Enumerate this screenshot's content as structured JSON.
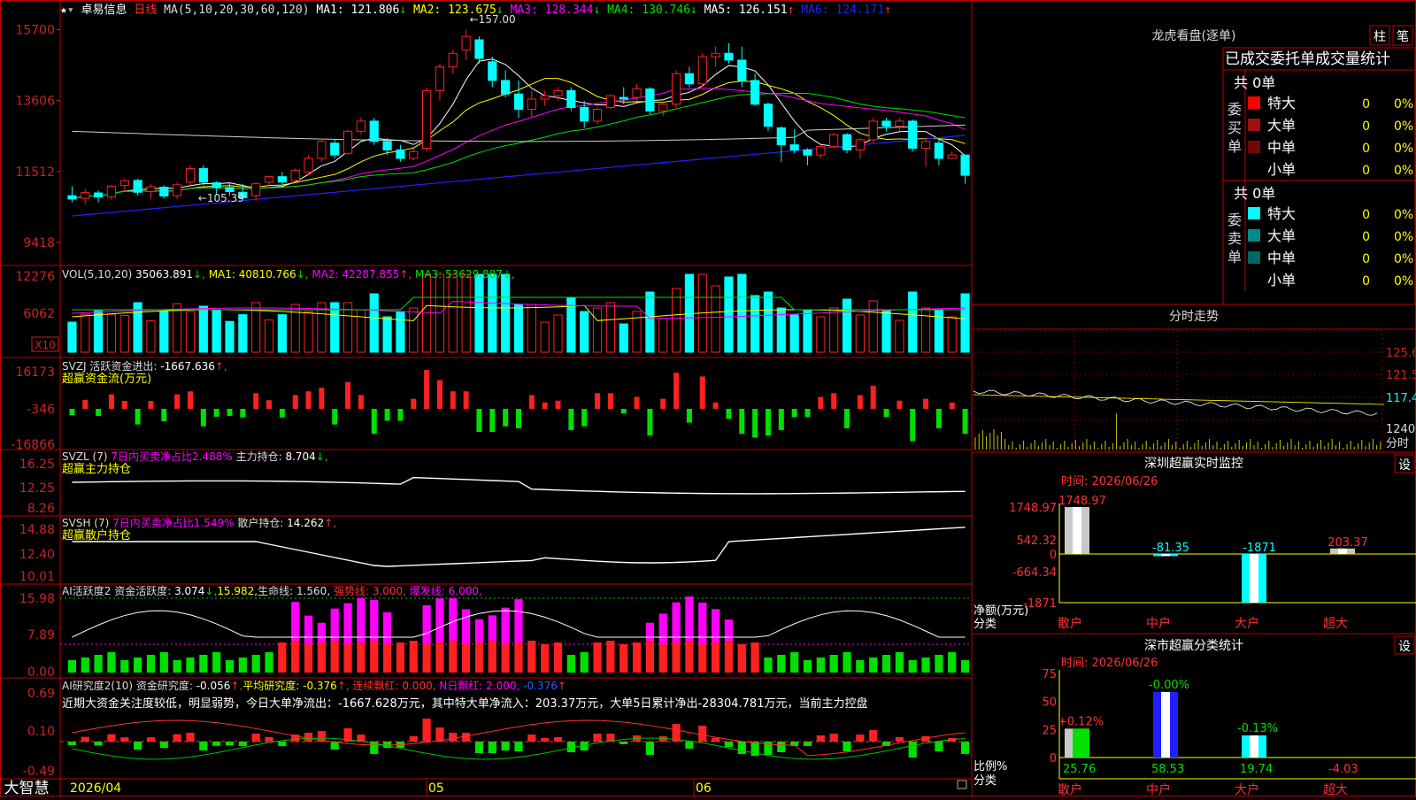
{
  "stock": {
    "name": "卓易信息",
    "period": "日线"
  },
  "brand": "大智慧",
  "colors": {
    "up": "#ff2020",
    "down": "#00ffff",
    "frame": "#c00000",
    "axis": "#d02020",
    "white": "#e8e8e8",
    "yellow": "#ffff00",
    "magenta": "#ff00ff",
    "green": "#00e000",
    "blue": "#1b1bff"
  },
  "kline": {
    "header": {
      "ma_set": "MA(5,10,20,30,60,120)",
      "ma": [
        {
          "name": "MA1",
          "value": "121.806",
          "arrow": "↓",
          "color": "#ffffff"
        },
        {
          "name": "MA2",
          "value": "123.675",
          "arrow": "↓",
          "color": "#ffff00"
        },
        {
          "name": "MA3",
          "value": "128.344",
          "arrow": "↓",
          "color": "#ff00ff"
        },
        {
          "name": "MA4",
          "value": "130.746",
          "arrow": "↓",
          "color": "#00e000"
        },
        {
          "name": "MA5",
          "value": "126.151",
          "arrow": "↑",
          "color": "#ffffff"
        },
        {
          "name": "MA6",
          "value": "124.171",
          "arrow": "↑",
          "color": "#2222ff"
        }
      ]
    },
    "y_ticks": [
      "15700",
      "13606",
      "11512",
      "9418"
    ],
    "annotations": {
      "high": "157.00",
      "low": "105.39"
    }
  },
  "volume": {
    "header": {
      "title": "VOL(5,10,20)",
      "value": "35063.891",
      "arrow": "↓",
      "ma": [
        {
          "name": "MA1",
          "value": "40810.766",
          "arrow": "↓",
          "color": "#ffff00"
        },
        {
          "name": "MA2",
          "value": "42287.855",
          "arrow": "↑",
          "color": "#ff00ff"
        },
        {
          "name": "MA3",
          "value": "53629.887",
          "arrow": "↓",
          "color": "#00e000"
        }
      ]
    },
    "y_ticks": [
      "12276",
      "6062"
    ],
    "unit": "X10"
  },
  "svzj": {
    "title": "SVZJ",
    "label": "活跃资金进出:",
    "value": "-1667.636",
    "arrow": "↑",
    "sub": "超赢资金流(万元)",
    "y_ticks": [
      "16173",
      "-346",
      "-16866"
    ]
  },
  "svzl": {
    "title": "SVZL (7)",
    "label1": "7日内买卖净占比2.488%",
    "label2": "主力持仓:",
    "value": "8.704",
    "arrow": "↓",
    "sub": "超赢主力持仓",
    "y_ticks": [
      "16.25",
      "12.25",
      "8.26"
    ]
  },
  "svsh": {
    "title": "SVSH (7)",
    "label1": "7日内买卖净占比1.549%",
    "label2": "散户持仓:",
    "value": "14.262",
    "arrow": "↑",
    "sub": "超赢散户持仓",
    "y_ticks": [
      "14.88",
      "12.40",
      "10.01"
    ]
  },
  "ai_active": {
    "title": "AI活跃度2",
    "label": "资金活跃度:",
    "value": "3.074",
    "arrow": "↓",
    "v2": "15.982",
    "life_label": "生命线:",
    "life": "1.560",
    "strong_label": "强势线:",
    "strong": "3.000",
    "burst_label": "爆发线:",
    "burst": "6.000",
    "y_ticks": [
      "15.98",
      "7.89",
      "0.00"
    ]
  },
  "ai_research": {
    "title": "AI研究度2(10)",
    "label": "资金研究度:",
    "value": "-0.056",
    "arrow": "↑",
    "avg_label": "平均研究度:",
    "avg": "-0.376",
    "avg_arrow": "↑",
    "red_label": "连续飘红:",
    "red": "0.000",
    "nred_label": "N日飘红:",
    "nred": "2.000",
    "last": "-0.376",
    "last_arrow": "↑",
    "commentary": "近期大资金关注度较低，明显弱势，今日大单净流出：-1667.628万元，其中特大单净流入：203.37万元，大单5日累计净出-28304.781万元，当前主力控盘",
    "y_ticks": [
      "0.69",
      "0.10",
      "-0.49"
    ]
  },
  "x_axis": {
    "start": "2026/04",
    "m1": "05",
    "m2": "06"
  },
  "right": {
    "lhb": {
      "title": "龙虎看盘(逐单)",
      "btn1": "柱",
      "btn2": "笔",
      "stats_title": "已成交委托单成交量统计",
      "buy": {
        "side": "委买单",
        "total": "共 0单",
        "rows": [
          {
            "name": "特大",
            "count": "0",
            "pct": "0%",
            "color": "#ff0000"
          },
          {
            "name": "大单",
            "count": "0",
            "pct": "0%",
            "color": "#a01010"
          },
          {
            "name": "中单",
            "count": "0",
            "pct": "0%",
            "color": "#700808"
          },
          {
            "name": "小单",
            "count": "0",
            "pct": "0%",
            "color": "#000000"
          }
        ]
      },
      "sell": {
        "side": "委卖单",
        "total": "共 0单",
        "rows": [
          {
            "name": "特大",
            "count": "0",
            "pct": "0%",
            "color": "#00ffff"
          },
          {
            "name": "大单",
            "count": "0",
            "pct": "0%",
            "color": "#008b8b"
          },
          {
            "name": "中单",
            "count": "0",
            "pct": "0%",
            "color": "#006666"
          },
          {
            "name": "小单",
            "count": "0",
            "pct": "0%",
            "color": "#000000"
          }
        ]
      }
    },
    "intraday": {
      "title": "分时走势",
      "ticks": [
        "125.6",
        "121.5",
        "117.4",
        "1240"
      ],
      "unit": "分时"
    },
    "monitor": {
      "title": "深圳超赢实时监控",
      "btn": "设",
      "date": "时间: 2026/06/26",
      "y_ticks": [
        "1748.97",
        "542.32",
        "0",
        "-664.34",
        "-1871"
      ],
      "unit_label": "净额(万元)",
      "cat_label": "分类",
      "categories": [
        "散户",
        "中户",
        "大户",
        "超大"
      ],
      "values": [
        1748.97,
        -81.35,
        -1871,
        203.37
      ],
      "labels": [
        "1748.97",
        "-81.35",
        "-1871",
        "203.37"
      ]
    },
    "classify": {
      "title": "深市超赢分类统计",
      "btn": "设",
      "date": "时间: 2026/06/26",
      "y_ticks": [
        "75",
        "50",
        "25",
        "0"
      ],
      "unit_label": "比例%",
      "cat_label": "分类",
      "categories": [
        "散户",
        "中户",
        "大户",
        "超大"
      ],
      "bars": [
        25.76,
        58.53,
        19.74,
        -4.03
      ],
      "bar_labels": [
        "25.76",
        "58.53",
        "19.74",
        "-4.03"
      ],
      "changes": [
        "+0.12%",
        "-0.00%",
        "-0.13%",
        ""
      ]
    }
  },
  "chart_data": {
    "type": "candlestick",
    "title": "卓易信息 日线",
    "ohlc": [
      [
        108.0,
        110.8,
        106.0,
        107.0
      ],
      [
        107.2,
        110.0,
        105.6,
        108.9
      ],
      [
        108.8,
        109.5,
        106.0,
        107.6
      ],
      [
        107.6,
        111.2,
        106.8,
        110.8
      ],
      [
        111.0,
        113.0,
        109.4,
        112.4
      ],
      [
        112.5,
        113.0,
        108.0,
        109.0
      ],
      [
        109.2,
        111.5,
        107.0,
        110.6
      ],
      [
        110.5,
        111.0,
        107.2,
        107.9
      ],
      [
        108.0,
        112.0,
        107.0,
        111.2
      ],
      [
        112.0,
        117.0,
        111.0,
        116.0
      ],
      [
        116.0,
        117.0,
        111.0,
        112.0
      ],
      [
        111.8,
        112.2,
        108.0,
        110.4
      ],
      [
        110.4,
        112.0,
        108.0,
        109.2
      ],
      [
        109.0,
        111.5,
        107.0,
        107.4
      ],
      [
        108.0,
        112.0,
        106.5,
        111.5
      ],
      [
        112.0,
        114.0,
        111.0,
        113.6
      ],
      [
        113.6,
        115.0,
        111.0,
        112.0
      ],
      [
        112.5,
        116.0,
        112.0,
        115.5
      ],
      [
        115.0,
        120.0,
        114.0,
        119.0
      ],
      [
        119.0,
        125.0,
        118.0,
        124.0
      ],
      [
        123.5,
        124.5,
        119.0,
        120.0
      ],
      [
        120.5,
        127.5,
        120.0,
        127.0
      ],
      [
        127.0,
        131.0,
        126.0,
        130.0
      ],
      [
        130.0,
        131.0,
        123.0,
        124.0
      ],
      [
        124.0,
        125.0,
        120.0,
        121.5
      ],
      [
        121.5,
        123.0,
        118.0,
        119.0
      ],
      [
        119.0,
        122.0,
        118.5,
        121.0
      ],
      [
        122.0,
        140.0,
        121.0,
        139.0
      ],
      [
        139.0,
        147.0,
        136.0,
        146.0
      ],
      [
        146.0,
        151.0,
        144.0,
        150.0
      ],
      [
        151.0,
        157.0,
        148.0,
        155.0
      ],
      [
        154.0,
        155.0,
        147.0,
        148.5
      ],
      [
        147.5,
        149.0,
        140.0,
        142.0
      ],
      [
        142.0,
        145.0,
        137.0,
        138.0
      ],
      [
        138.0,
        142.0,
        131.0,
        133.5
      ],
      [
        133.5,
        139.0,
        131.0,
        136.5
      ],
      [
        136.5,
        139.0,
        134.5,
        137.5
      ],
      [
        137.5,
        140.0,
        136.0,
        139.0
      ],
      [
        139.0,
        140.0,
        133.0,
        134.0
      ],
      [
        134.0,
        136.0,
        128.0,
        130.0
      ],
      [
        130.0,
        134.0,
        129.0,
        133.5
      ],
      [
        134.0,
        138.0,
        133.5,
        137.5
      ],
      [
        137.0,
        140.0,
        135.0,
        136.5
      ],
      [
        137.0,
        141.0,
        136.0,
        139.5
      ],
      [
        139.5,
        140.0,
        132.0,
        133.0
      ],
      [
        133.0,
        136.0,
        131.5,
        135.0
      ],
      [
        135.0,
        145.0,
        134.0,
        144.0
      ],
      [
        144.0,
        146.0,
        140.0,
        141.0
      ],
      [
        141.0,
        150.0,
        140.0,
        149.0
      ],
      [
        149.0,
        152.0,
        146.0,
        150.0
      ],
      [
        150.0,
        153.0,
        147.0,
        148.0
      ],
      [
        148.0,
        152.0,
        140.0,
        142.0
      ],
      [
        142.0,
        144.0,
        134.5,
        135.0
      ],
      [
        135.0,
        135.5,
        127.0,
        128.5
      ],
      [
        128.0,
        128.5,
        118.0,
        123.0
      ],
      [
        123.0,
        127.5,
        120.5,
        121.5
      ],
      [
        121.5,
        122.0,
        117.0,
        120.0
      ],
      [
        120.0,
        123.0,
        119.0,
        122.5
      ],
      [
        122.5,
        126.5,
        122.0,
        126.0
      ],
      [
        126.0,
        126.5,
        120.5,
        121.5
      ],
      [
        121.5,
        125.0,
        119.0,
        124.5
      ],
      [
        124.5,
        131.0,
        123.5,
        130.0
      ],
      [
        130.0,
        131.0,
        127.0,
        128.5
      ],
      [
        128.5,
        131.0,
        127.0,
        130.0
      ],
      [
        130.0,
        130.5,
        121.0,
        122.0
      ],
      [
        122.0,
        125.0,
        116.5,
        124.0
      ],
      [
        123.5,
        125.0,
        117.0,
        119.0
      ],
      [
        119.0,
        121.0,
        119.0,
        120.0
      ],
      [
        120.0,
        120.0,
        111.5,
        114.0
      ]
    ],
    "y_unit": "price",
    "ylim": [
      94.18,
      157.0
    ]
  }
}
